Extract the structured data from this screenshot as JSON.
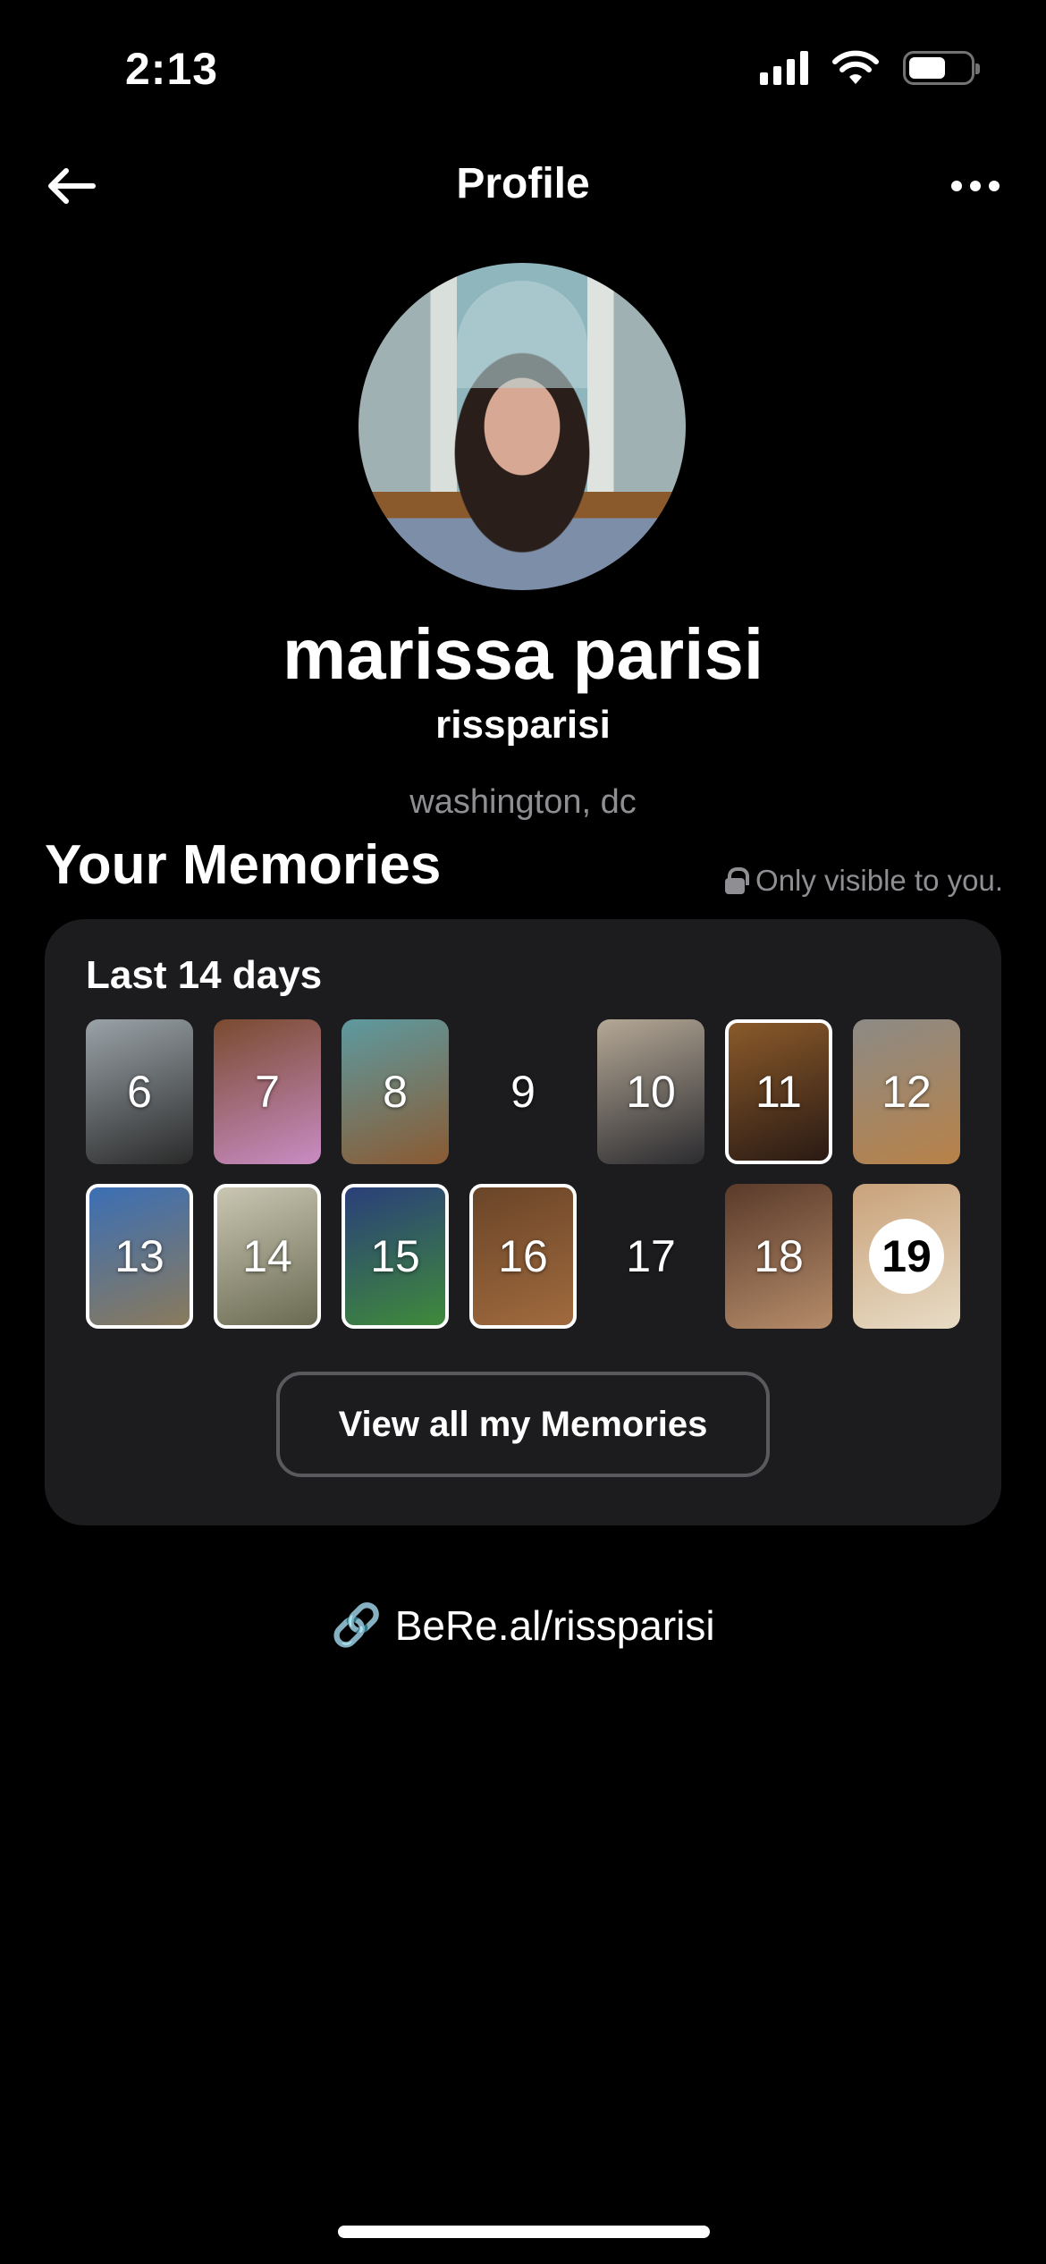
{
  "status_bar": {
    "time": "2:13",
    "battery_level": 0.6
  },
  "header": {
    "title": "Profile",
    "back_icon": "arrow-left-icon",
    "more_icon": "ellipsis-icon"
  },
  "profile": {
    "display_name": "marissa parisi",
    "username": "rissparisi",
    "location": "washington, dc"
  },
  "memories": {
    "title": "Your Memories",
    "visibility_note": "Only visible to you.",
    "card_title": "Last 14 days",
    "days": [
      {
        "label": "6",
        "has_photo": true,
        "highlighted": false,
        "colors": [
          "#9aa3a8",
          "#2a2a2a"
        ]
      },
      {
        "label": "7",
        "has_photo": true,
        "highlighted": false,
        "colors": [
          "#7a4a2e",
          "#c98cc4"
        ]
      },
      {
        "label": "8",
        "has_photo": true,
        "highlighted": false,
        "colors": [
          "#5d9aa0",
          "#8a5a32"
        ]
      },
      {
        "label": "9",
        "has_photo": false,
        "highlighted": false,
        "colors": []
      },
      {
        "label": "10",
        "has_photo": true,
        "highlighted": false,
        "colors": [
          "#b5a896",
          "#2b2b2f"
        ]
      },
      {
        "label": "11",
        "has_photo": true,
        "highlighted": true,
        "colors": [
          "#8a5a2a",
          "#2a1a14"
        ]
      },
      {
        "label": "12",
        "has_photo": true,
        "highlighted": false,
        "colors": [
          "#8c8a86",
          "#b88248"
        ]
      },
      {
        "label": "13",
        "has_photo": true,
        "highlighted": true,
        "colors": [
          "#3b6fb5",
          "#8a7a5c"
        ]
      },
      {
        "label": "14",
        "has_photo": true,
        "highlighted": true,
        "colors": [
          "#c9c6b2",
          "#6a6a52"
        ]
      },
      {
        "label": "15",
        "has_photo": true,
        "highlighted": true,
        "colors": [
          "#2a3f7a",
          "#3f8a3a"
        ]
      },
      {
        "label": "16",
        "has_photo": true,
        "highlighted": true,
        "colors": [
          "#6a4528",
          "#a06a3e"
        ]
      },
      {
        "label": "17",
        "has_photo": false,
        "highlighted": false,
        "colors": []
      },
      {
        "label": "18",
        "has_photo": true,
        "highlighted": false,
        "colors": [
          "#5a3a2a",
          "#b58c6a"
        ]
      },
      {
        "label": "19",
        "has_photo": true,
        "highlighted": false,
        "today": true,
        "colors": [
          "#c9a27a",
          "#e8dcc6"
        ]
      }
    ],
    "view_all_label": "View all my Memories"
  },
  "link": {
    "text": "BeRe.al/rissparisi",
    "icon": "link-icon"
  }
}
